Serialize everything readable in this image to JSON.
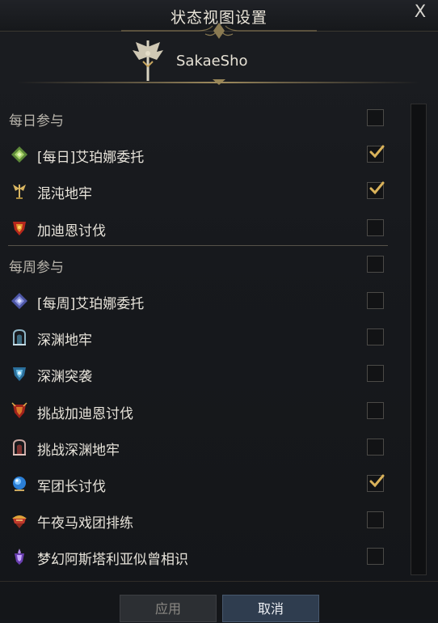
{
  "dialog": {
    "title": "状态视图设置",
    "close_label": "X",
    "character_name": "SakaeSho"
  },
  "sections": [
    {
      "title": "每日参与",
      "checked": false,
      "items": [
        {
          "label": "[每日]艾珀娜委托",
          "icon": "daily-diamond-icon",
          "checked": true
        },
        {
          "label": "混沌地牢",
          "icon": "chaos-dungeon-icon",
          "checked": true
        },
        {
          "label": "加迪恩讨伐",
          "icon": "guardian-raid-icon",
          "checked": false
        }
      ]
    },
    {
      "title": "每周参与",
      "checked": false,
      "items": [
        {
          "label": "[每周]艾珀娜委托",
          "icon": "weekly-diamond-icon",
          "checked": false
        },
        {
          "label": "深渊地牢",
          "icon": "abyss-dungeon-icon",
          "checked": false
        },
        {
          "label": "深渊突袭",
          "icon": "abyss-raid-icon",
          "checked": false
        },
        {
          "label": "挑战加迪恩讨伐",
          "icon": "challenge-guardian-icon",
          "checked": false
        },
        {
          "label": "挑战深渊地牢",
          "icon": "challenge-abyss-icon",
          "checked": false
        },
        {
          "label": "军团长讨伐",
          "icon": "legion-raid-icon",
          "checked": true
        },
        {
          "label": "午夜马戏团排练",
          "icon": "circus-icon",
          "checked": false
        },
        {
          "label": "梦幻阿斯塔利亚似曾相识",
          "icon": "dream-icon",
          "checked": false
        }
      ]
    }
  ],
  "buttons": {
    "apply": "应用",
    "cancel": "取消"
  }
}
